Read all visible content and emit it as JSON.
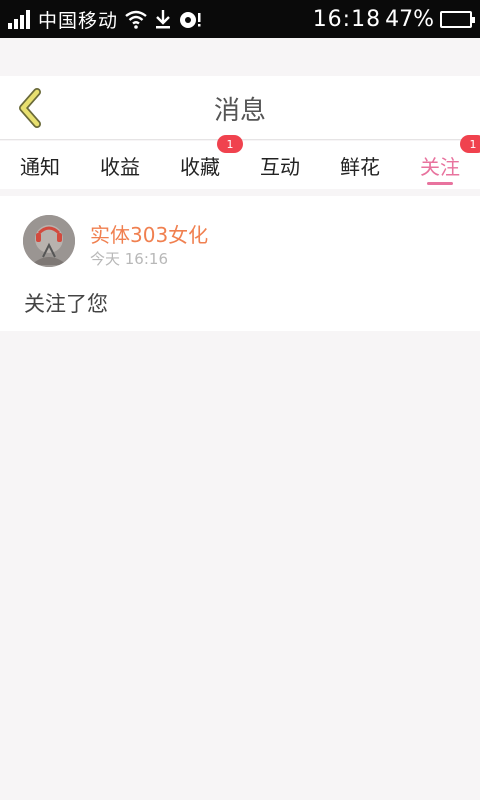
{
  "status_bar": {
    "carrier": "中国移动",
    "time": "16:18",
    "battery": "47%",
    "battery_level": 0.47,
    "icons": [
      "signal-icon",
      "wifi-icon",
      "download-icon",
      "sync-icon",
      "battery-icon"
    ]
  },
  "header": {
    "title": "消息",
    "back_icon": "chevron-left-icon"
  },
  "tabs": [
    {
      "label": "通知",
      "badge": null,
      "active": false
    },
    {
      "label": "收益",
      "badge": null,
      "active": false
    },
    {
      "label": "收藏",
      "badge": "1",
      "active": false
    },
    {
      "label": "互动",
      "badge": null,
      "active": false
    },
    {
      "label": "鲜花",
      "badge": null,
      "active": false
    },
    {
      "label": "关注",
      "badge": "1",
      "active": true
    }
  ],
  "message": {
    "sender": "实体303女化",
    "time": "今天 16:16",
    "text": "关注了您"
  },
  "colors": {
    "accent": "#e8739e",
    "badge": "#f0424e",
    "sender": "#f08050",
    "back_icon": "#e0d870"
  }
}
